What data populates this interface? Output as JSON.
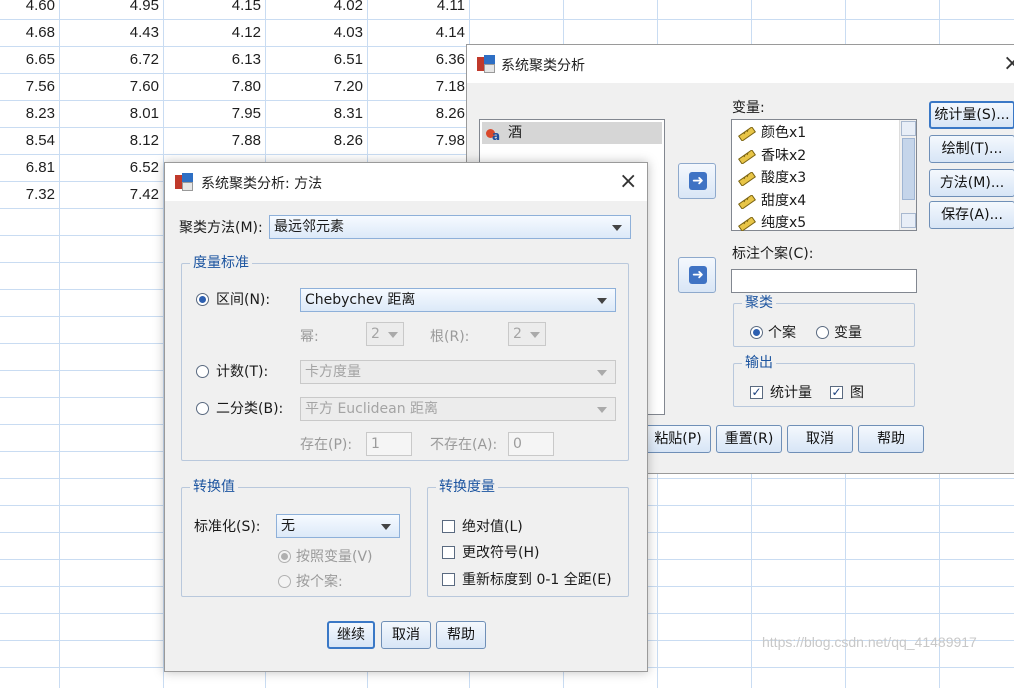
{
  "sheet": {
    "rows": [
      [
        "4.60",
        "4.95",
        "4.15",
        "4.02",
        "4.11"
      ],
      [
        "4.68",
        "4.43",
        "4.12",
        "4.03",
        "4.14"
      ],
      [
        "6.65",
        "6.72",
        "6.13",
        "6.51",
        "6.36"
      ],
      [
        "7.56",
        "7.60",
        "7.80",
        "7.20",
        "7.18"
      ],
      [
        "8.23",
        "8.01",
        "7.95",
        "8.31",
        "8.26"
      ],
      [
        "8.54",
        "8.12",
        "7.88",
        "8.26",
        "7.98"
      ],
      [
        "6.81",
        "6.52",
        "",
        "",
        ""
      ],
      [
        "7.32",
        "7.42",
        "",
        "",
        ""
      ]
    ]
  },
  "main_dialog": {
    "title": "系统聚类分析",
    "source_list": {
      "items": [
        "酒"
      ]
    },
    "variables_label": "变量:",
    "variables": [
      "颜色x1",
      "香味x2",
      "酸度x3",
      "甜度x4",
      "纯度x5"
    ],
    "label_cases_label": "标注个案(C):",
    "label_cases_value": "",
    "side_buttons": [
      "统计量(S)...",
      "绘制(T)...",
      "方法(M)...",
      "保存(A)..."
    ],
    "cluster_group": {
      "title": "聚类",
      "options": [
        "个案",
        "变量"
      ],
      "selected": "个案"
    },
    "output_group": {
      "title": "输出",
      "options": [
        "统计量",
        "图"
      ]
    },
    "bottom_buttons": [
      "粘贴(P)",
      "重置(R)",
      "取消",
      "帮助"
    ]
  },
  "method_dialog": {
    "title": "系统聚类分析: 方法",
    "cluster_method_label": "聚类方法(M):",
    "cluster_method_value": "最远邻元素",
    "measure_group": {
      "title": "度量标准",
      "interval_label": "区间(N):",
      "interval_value": "Chebychev 距离",
      "power_label": "幂:",
      "power_value": "2",
      "root_label": "根(R):",
      "root_value": "2",
      "counts_label": "计数(T):",
      "counts_value": "卡方度量",
      "binary_label": "二分类(B):",
      "binary_value": "平方 Euclidean 距离",
      "present_label": "存在(P):",
      "present_value": "1",
      "absent_label": "不存在(A):",
      "absent_value": "0"
    },
    "transform_values": {
      "title": "转换值",
      "standardize_label": "标准化(S):",
      "standardize_value": "无",
      "by_variable": "按照变量(V)",
      "by_case": "按个案:"
    },
    "transform_measures": {
      "title": "转换度量",
      "absolute": "绝对值(L)",
      "change_sign": "更改符号(H)",
      "rescale": "重新标度到 0-1 全距(E)"
    },
    "buttons": [
      "继续",
      "取消",
      "帮助"
    ]
  },
  "watermark": "https://blog.csdn.net/qq_41489917",
  "colors": {
    "accent": "#3a78c6",
    "group_label": "#1d55a0",
    "grid": "#c9dcf2"
  }
}
